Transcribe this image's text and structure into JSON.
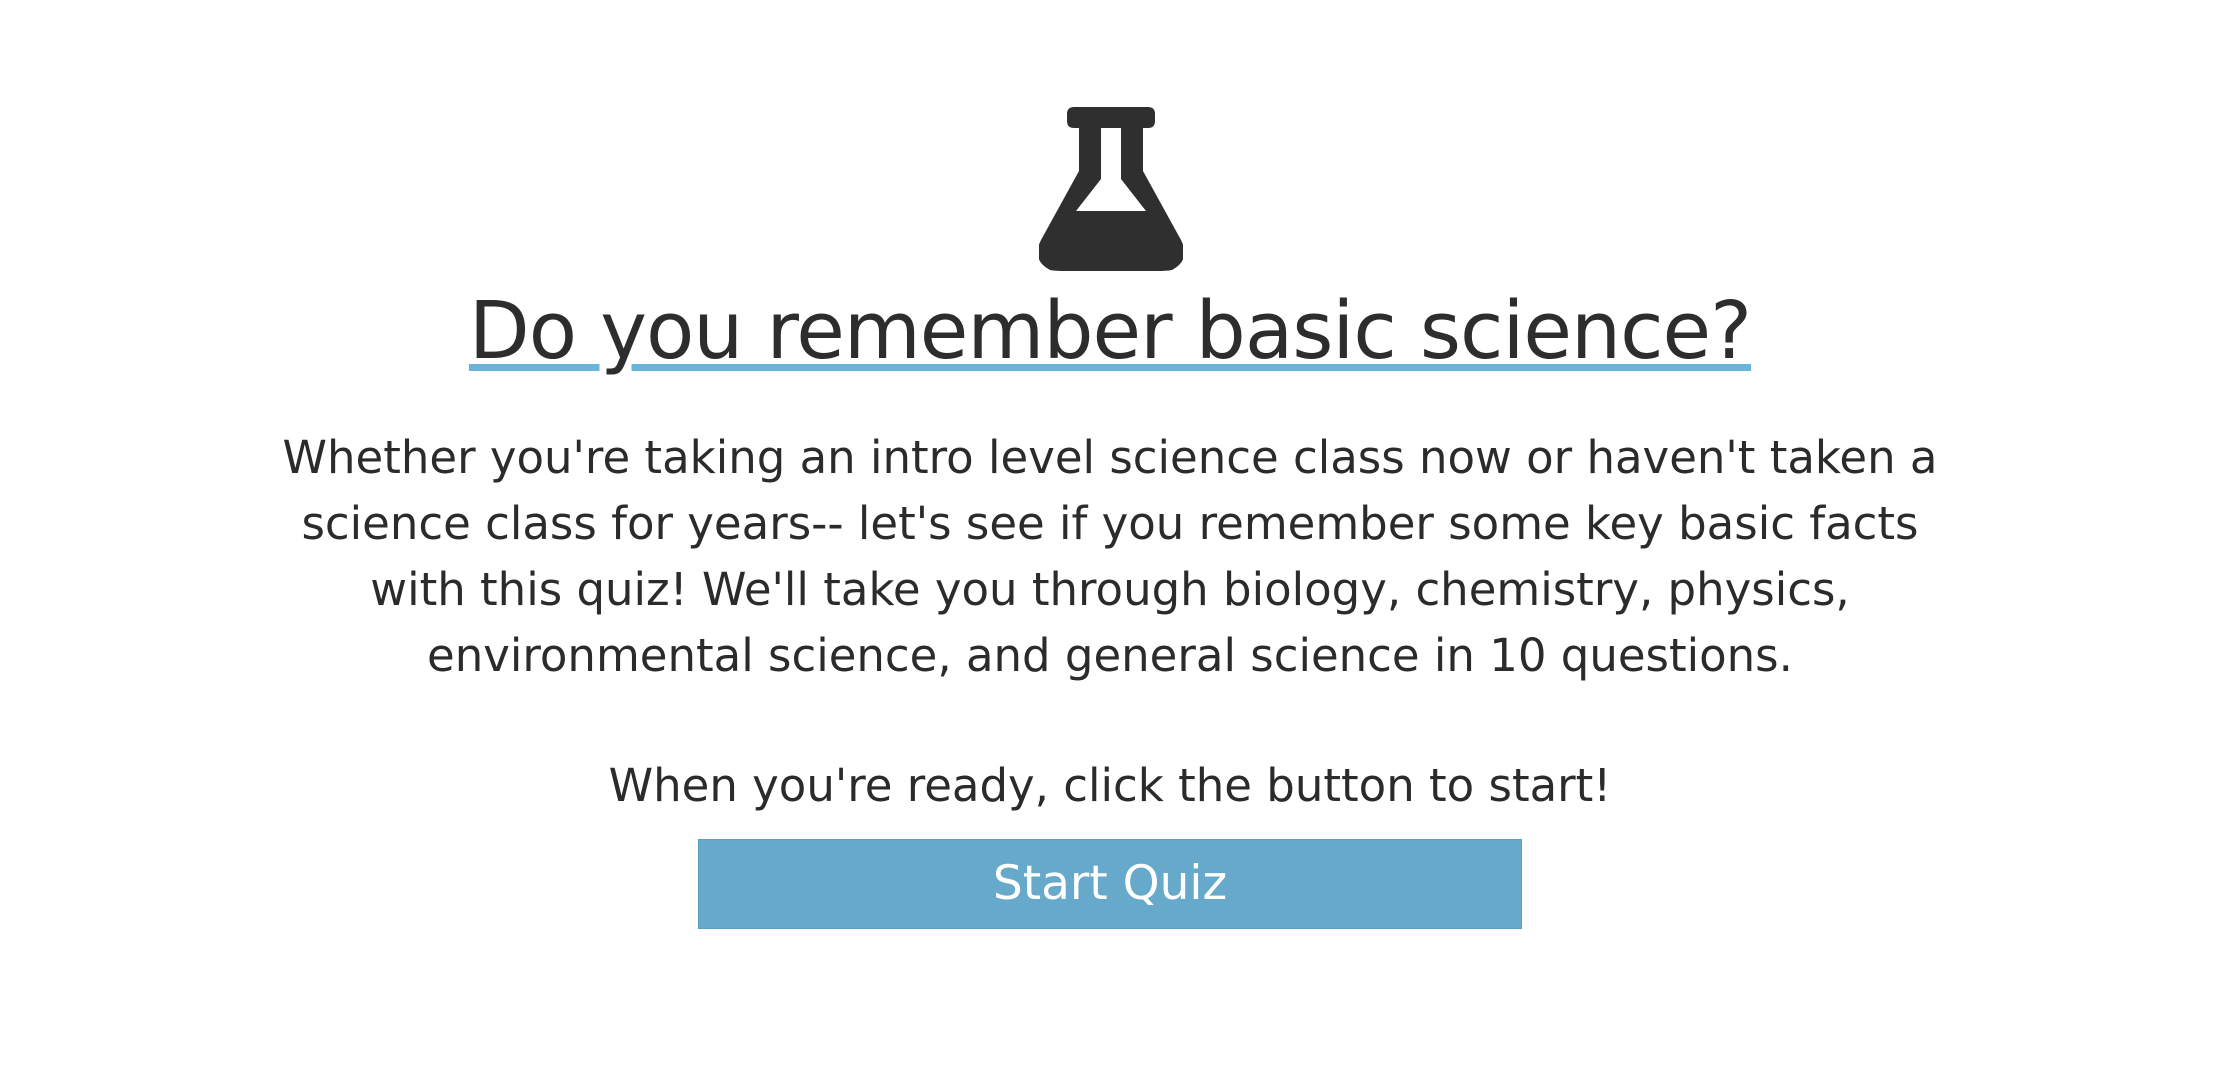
{
  "intro": {
    "icon": "flask-icon",
    "title": "Do you remember basic science?",
    "description": "Whether you're taking an intro level science class now or haven't taken a science class for years-- let's see if you remember some key basic facts with this quiz! We'll take you through biology, chemistry, physics, environmental science, and general science in 10 questions.",
    "prompt": "When you're ready, click the button to start!",
    "start_label": "Start Quiz"
  },
  "colors": {
    "text": "#2b2b2b",
    "accent": "#67a9cb",
    "underline": "#6ab4d8",
    "button_text": "#ffffff"
  }
}
